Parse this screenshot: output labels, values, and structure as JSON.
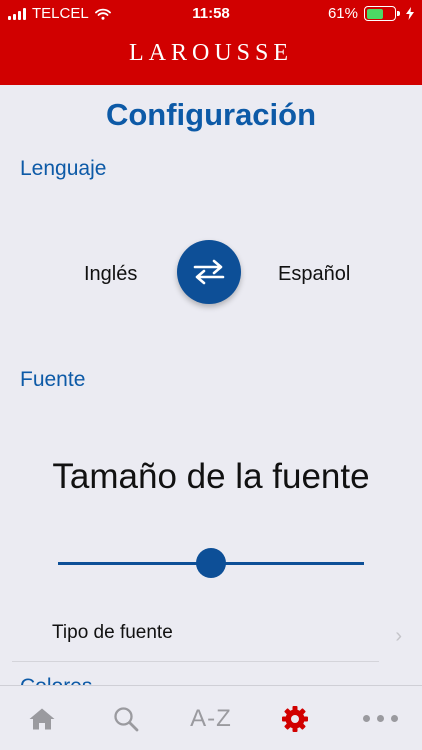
{
  "status_bar": {
    "carrier": "TELCEL",
    "time": "11:58",
    "battery_percent": "61%",
    "battery_level": 0.61,
    "battery_color": "#4cd964"
  },
  "header": {
    "brand": "LAROUSSE",
    "background": "#d10000"
  },
  "page": {
    "title": "Configuración",
    "accent_color": "#0d5aa7"
  },
  "language_section": {
    "label": "Lenguaje",
    "source": "Inglés",
    "target": "Español",
    "swap_icon": "swap-arrows-icon"
  },
  "font_section": {
    "label": "Fuente",
    "size_title": "Tamaño de la fuente",
    "size_slider_value": 0.5,
    "font_type_label": "Tipo de fuente",
    "font_type_icon": "chevron-right-icon"
  },
  "colors_section": {
    "label": "Colores"
  },
  "tab_bar": {
    "tabs": [
      {
        "icon": "home-icon",
        "active": false
      },
      {
        "icon": "search-icon",
        "active": false
      },
      {
        "label": "A-Z",
        "active": false
      },
      {
        "icon": "gear-icon",
        "active": true
      },
      {
        "icon": "more-icon",
        "active": false
      }
    ],
    "active_color": "#d10000",
    "inactive_color": "#9a9a9f"
  }
}
